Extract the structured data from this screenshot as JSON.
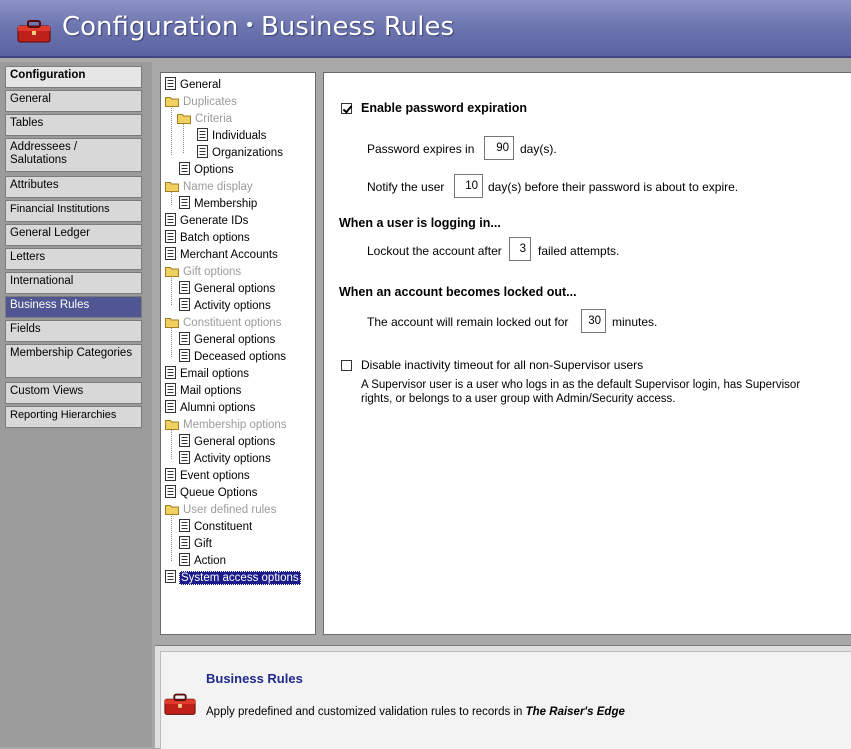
{
  "header": {
    "section": "Configuration",
    "separator": "•",
    "page": "Business Rules"
  },
  "nav": {
    "items": [
      {
        "label": "Configuration",
        "top": 0
      },
      {
        "label": "General"
      },
      {
        "label": "Tables"
      },
      {
        "label": "Addressees / Salutations"
      },
      {
        "label": "Attributes"
      },
      {
        "label": "Financial Institutions"
      },
      {
        "label": "General Ledger"
      },
      {
        "label": "Letters"
      },
      {
        "label": "International"
      },
      {
        "label": "Business Rules"
      },
      {
        "label": "Fields"
      },
      {
        "label": "Membership Categories"
      },
      {
        "label": "Custom Views"
      },
      {
        "label": "Reporting Hierarchies"
      }
    ]
  },
  "tree": {
    "general": "General",
    "duplicates": "Duplicates",
    "criteria": "Criteria",
    "individuals": "Individuals",
    "organizations": "Organizations",
    "dup_options": "Options",
    "name_display": "Name display",
    "membership": "Membership",
    "generate_ids": "Generate IDs",
    "batch_options": "Batch options",
    "merchant_accounts": "Merchant Accounts",
    "gift_options": "Gift options",
    "gift_general": "General options",
    "gift_activity": "Activity options",
    "constituent_options": "Constituent options",
    "const_general": "General options",
    "const_deceased": "Deceased options",
    "email_options": "Email options",
    "mail_options": "Mail options",
    "alumni_options": "Alumni options",
    "membership_options": "Membership options",
    "mem_general": "General options",
    "mem_activity": "Activity options",
    "event_options": "Event options",
    "queue_options": "Queue Options",
    "user_defined_rules": "User defined rules",
    "udr_constituent": "Constituent",
    "udr_gift": "Gift",
    "udr_action": "Action",
    "system_access": "System access options"
  },
  "detail": {
    "enable_expiration": {
      "label": "Enable password expiration",
      "checked": true
    },
    "expires_prefix": "Password expires in",
    "expires_value": "90",
    "expires_suffix": "day(s).",
    "notify_prefix": "Notify the user",
    "notify_value": "10",
    "notify_suffix": "day(s) before their password is about to expire.",
    "logging_heading": "When a user is logging in...",
    "lockout_prefix": "Lockout the account after",
    "lockout_value": "3",
    "lockout_suffix": "failed attempts.",
    "locked_heading": "When an account becomes locked out...",
    "locked_prefix": "The account will remain locked out for",
    "locked_value": "30",
    "locked_suffix": "minutes.",
    "inactivity": {
      "label": "Disable inactivity timeout for all non-Supervisor users",
      "checked": false
    },
    "note_line1": "A Supervisor user is a user who logs in as the default Supervisor login, has Supervisor",
    "note_line2": "rights, or belongs to a user group with Admin/Security access."
  },
  "footer": {
    "title": "Business Rules",
    "description_prefix": "Apply predefined and customized validation rules to records in ",
    "description_product": "The Raiser's Edge"
  },
  "colors": {
    "title_bar": "#6e76b0",
    "active_nav": "#4f5691",
    "footer_title": "#1f2a8a"
  }
}
